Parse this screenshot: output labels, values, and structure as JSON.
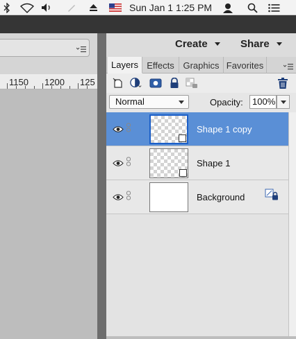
{
  "menubar": {
    "clock": "Sun Jan 1  1:25 PM",
    "icons": [
      "bluetooth-icon",
      "wifi-icon",
      "volume-icon",
      "pen-icon",
      "eject-icon",
      "flag-icon",
      "user-icon",
      "spotlight-icon",
      "notification-icon"
    ]
  },
  "toolbar": {
    "create_label": "Create",
    "share_label": "Share"
  },
  "ruler": {
    "ticks": [
      "1150",
      "1200",
      "125"
    ]
  },
  "panel": {
    "tabs": [
      {
        "label": "Layers",
        "active": true
      },
      {
        "label": "Effects",
        "active": false
      },
      {
        "label": "Graphics",
        "active": false
      },
      {
        "label": "Favorites",
        "active": false
      }
    ],
    "blend_mode": "Normal",
    "opacity_label": "Opacity:",
    "opacity_value": "100%"
  },
  "layers": [
    {
      "name": "Shape 1 copy",
      "selected": true,
      "transparent": true,
      "shape": true
    },
    {
      "name": "Shape 1",
      "selected": false,
      "transparent": true,
      "shape": true
    },
    {
      "name": "Background",
      "selected": false,
      "transparent": false,
      "locked": true
    }
  ],
  "colors": {
    "selection": "#5a8fd6",
    "dark_strip": "#353535"
  }
}
